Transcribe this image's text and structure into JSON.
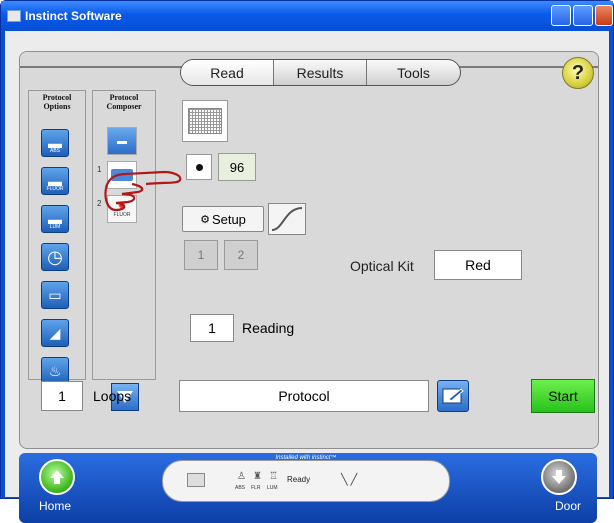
{
  "window": {
    "title": "Instinct Software"
  },
  "tabs": [
    {
      "label": "Read",
      "active": true
    },
    {
      "label": "Results",
      "active": false
    },
    {
      "label": "Tools",
      "active": false
    }
  ],
  "help": {
    "label": "?"
  },
  "protocol_options": {
    "title_line1": "Protocol",
    "title_line2": "Options",
    "buttons": [
      {
        "icon": "abs-read-icon",
        "sub": "ABS"
      },
      {
        "icon": "fluor-read-icon",
        "sub": "FLUOR"
      },
      {
        "icon": "lum-read-icon",
        "sub": "LUM"
      },
      {
        "icon": "timer-icon",
        "sub": ""
      },
      {
        "icon": "plate-icon",
        "sub": ""
      },
      {
        "icon": "kinetic-icon",
        "sub": ""
      },
      {
        "icon": "shake-icon",
        "sub": ""
      }
    ]
  },
  "protocol_composer": {
    "title_line1": "Protocol",
    "title_line2": "Composer",
    "items": [
      {
        "num": "",
        "label": "ABS"
      },
      {
        "num": "1",
        "label": ""
      },
      {
        "num": "2",
        "label": "FLUOR"
      }
    ]
  },
  "read": {
    "wells": "96",
    "setup_label": "Setup",
    "optical_kit_label": "Optical Kit",
    "optical_kit_value": "Red",
    "reading_count": "1",
    "reading_label": "Reading",
    "step1": "1",
    "step2": "2"
  },
  "bottom": {
    "loops_count": "1",
    "loops_label": "Loops",
    "protocol_label": "Protocol",
    "start_label": "Start"
  },
  "footer": {
    "home_label": "Home",
    "door_label": "Door",
    "caption": "Installed with instinct™",
    "status": "Ready",
    "mini_labels": [
      "ABS",
      "FLR",
      "LUM"
    ]
  },
  "colors": {
    "title_blue": "#0a4fd0",
    "start_green": "#27c21a",
    "footer_blue": "#1a4fbf"
  }
}
